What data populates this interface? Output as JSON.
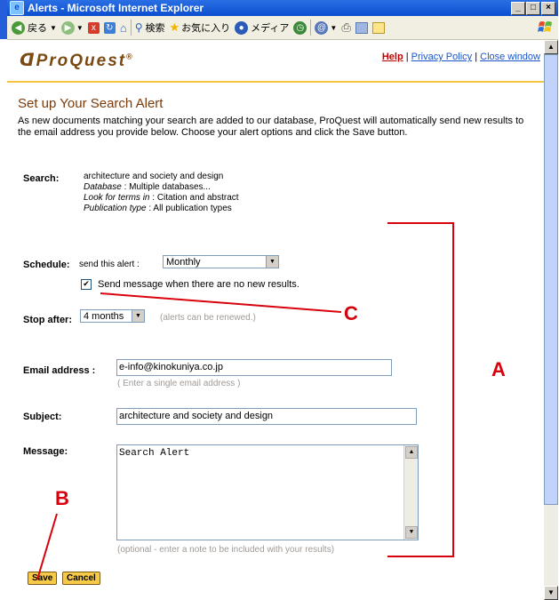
{
  "window": {
    "title": "Alerts - Microsoft Internet Explorer"
  },
  "toolbar": {
    "back": "戻る",
    "search": "検索",
    "favorites": "お気に入り",
    "media": "メディア"
  },
  "header": {
    "logo": "ProQuest",
    "logo_mark": "®",
    "help": "Help",
    "separator": "|",
    "privacy": "Privacy Policy",
    "close": "Close window"
  },
  "page": {
    "title": "Set up Your Search Alert",
    "intro": "As new documents matching your search are added to our database, ProQuest will automatically send new results to the email address you provide below. Choose your alert options and click the Save button."
  },
  "search": {
    "label": "Search:",
    "query": "architecture and society and design",
    "database_label": "Database",
    "database_value": " : Multiple databases...",
    "look_label": "Look for terms in",
    "look_value": " : Citation and abstract",
    "pubtype_label": "Publication type",
    "pubtype_value": " : All publication types"
  },
  "schedule": {
    "label": "Schedule:",
    "prompt": "send this alert :",
    "selected": "Monthly",
    "checkbox_label": "Send message when there are no new results.",
    "checked": true
  },
  "stop": {
    "label": "Stop after:",
    "selected": "4 months",
    "note": "(alerts can be renewed.)"
  },
  "email": {
    "label": "Email  address :",
    "value": "e-info@kinokuniya.co.jp",
    "hint": "( Enter a single email address )"
  },
  "subject": {
    "label": "Subject:",
    "value": "architecture and society and design"
  },
  "message": {
    "label": "Message:",
    "value": "Search Alert",
    "hint": "(optional - enter a note to be included with your results)"
  },
  "buttons": {
    "save": "Save",
    "cancel": "Cancel"
  },
  "annotations": {
    "a": "A",
    "b": "B",
    "c": "C",
    "color": "#d8000c"
  }
}
